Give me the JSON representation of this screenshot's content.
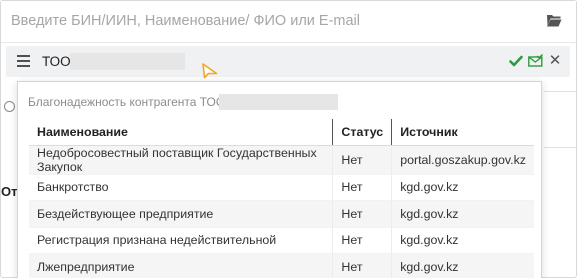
{
  "search": {
    "placeholder": "Введите БИН/ИИН, Наименование/ ФИО или E-mail",
    "value": ""
  },
  "tag": {
    "name": "ТОО"
  },
  "popup": {
    "title": "Благонадежность контрагента ТОО",
    "columns": [
      "Наименование",
      "Статус",
      "Источник"
    ],
    "rows": [
      {
        "name": "Недобросовестный поставщик Государственных Закупок",
        "status": "Нет",
        "source": "portal.goszakup.gov.kz"
      },
      {
        "name": "Банкротство",
        "status": "Нет",
        "source": "kgd.gov.kz"
      },
      {
        "name": "Бездействующее предприятие",
        "status": "Нет",
        "source": "kgd.gov.kz"
      },
      {
        "name": "Регистрация признана недействительной",
        "status": "Нет",
        "source": "kgd.gov.kz"
      },
      {
        "name": "Лжепредприятие",
        "status": "Нет",
        "source": "kgd.gov.kz"
      }
    ]
  },
  "background": {
    "label": "От"
  },
  "colors": {
    "check": "#2e9b3a",
    "mail": "#2e9b3a",
    "cursor": "#f5a623"
  }
}
